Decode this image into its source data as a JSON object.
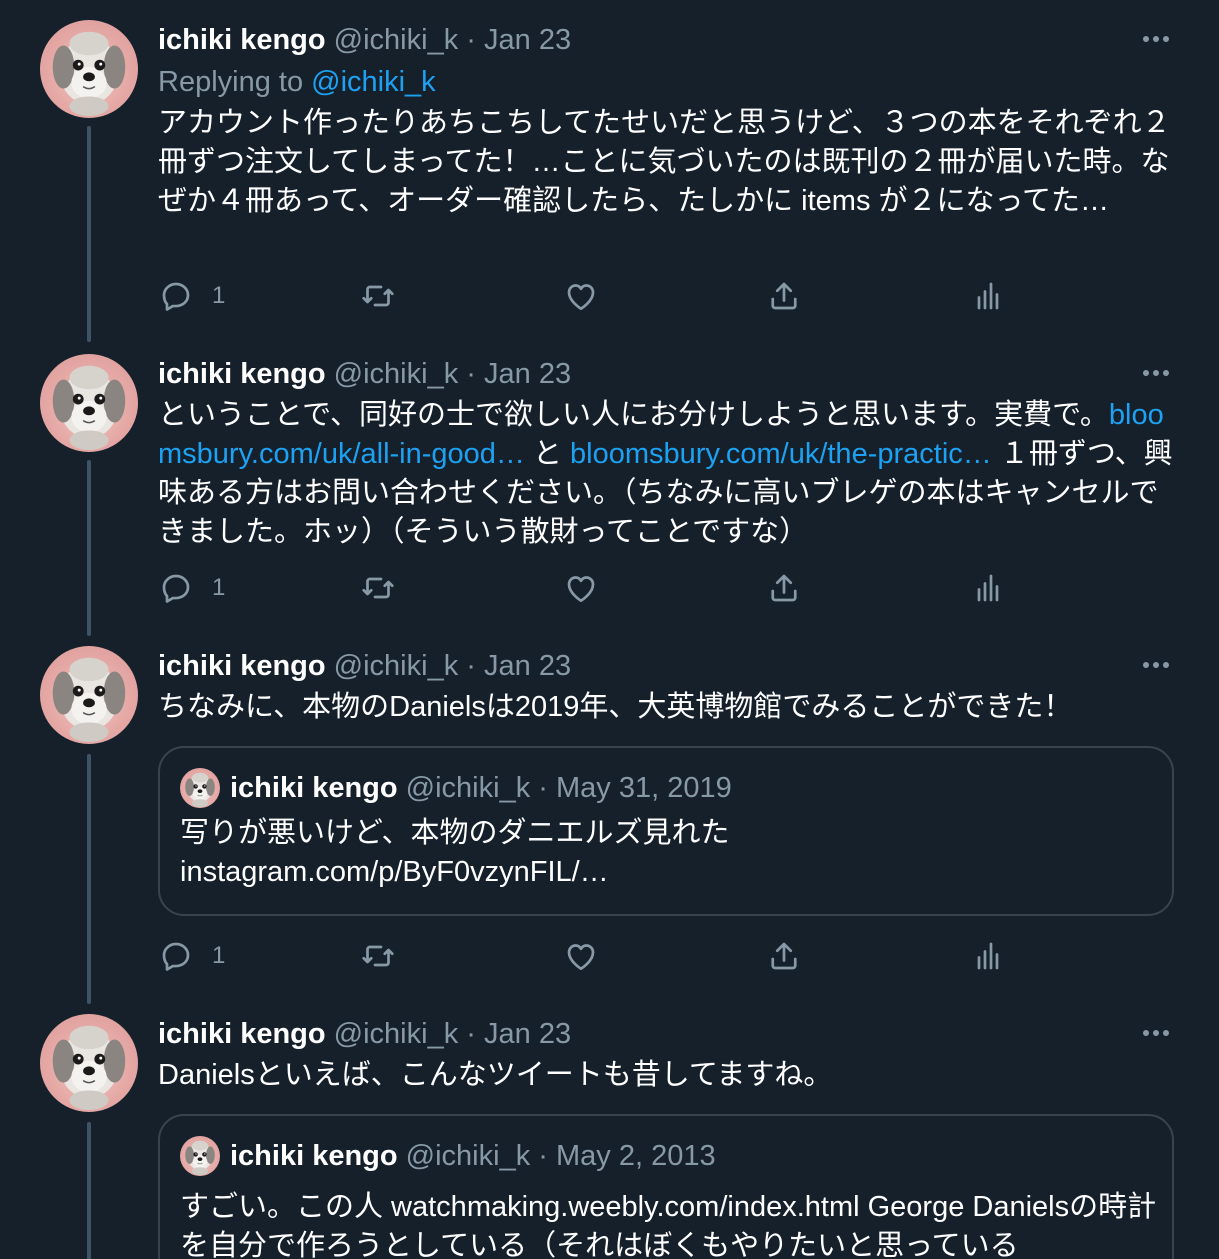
{
  "tweets": [
    {
      "name": "ichiki kengo",
      "handle": "@ichiki_k",
      "separator": "·",
      "date": "Jan 23",
      "replying_prefix": "Replying to ",
      "replying_handle": "@ichiki_k",
      "text": "アカウント作ったりあちこちしてたせいだと思うけど、３つの本をそれぞれ２冊ずつ注文してしまってた！…ことに気づいたのは既刊の２冊が届いた時。なぜか４冊あって、オーダー確認したら、たしかに items が２になってた…",
      "reply_count": "1"
    },
    {
      "name": "ichiki kengo",
      "handle": "@ichiki_k",
      "separator": "·",
      "date": "Jan 23",
      "text_part1": "ということで、同好の士で欲しい人にお分けしようと思います。実費で。",
      "link1": "bloomsbury.com/uk/all-in-good…",
      "text_part2": " と ",
      "link2": "bloomsbury.com/uk/the-practic…",
      "text_part3": " １冊ずつ、興味ある方はお問い合わせください。（ちなみに高いブレゲの本はキャンセルできました。ホッ）（そういう散財ってことですな）",
      "reply_count": "1"
    },
    {
      "name": "ichiki kengo",
      "handle": "@ichiki_k",
      "separator": "·",
      "date": "Jan 23",
      "text": "ちなみに、本物のDanielsは2019年、大英博物館でみることができた！",
      "quote": {
        "name": "ichiki kengo",
        "handle": "@ichiki_k",
        "separator": "·",
        "date": "May 31, 2019",
        "text": "写りが悪いけど、本物のダニエルズ見れた\ninstagram.com/p/ByF0vzynFIL/…"
      },
      "reply_count": "1"
    },
    {
      "name": "ichiki kengo",
      "handle": "@ichiki_k",
      "separator": "·",
      "date": "Jan 23",
      "text": "Danielsといえば、こんなツイートも昔してますね。",
      "quote": {
        "name": "ichiki kengo",
        "handle": "@ichiki_k",
        "separator": "·",
        "date": "May 2, 2013",
        "text": "すごい。この人 watchmaking.weebly.com/index.html George Danielsの時計を自分で作ろうとしている（それはぼくもやりたいと思っている"
      }
    }
  ],
  "icons": {
    "reply": "reply-icon",
    "retweet": "retweet-icon",
    "like": "like-icon",
    "share": "share-icon",
    "analytics": "analytics-icon",
    "more": "more-icon"
  },
  "colors": {
    "background": "#15202b",
    "text": "#ffffff",
    "secondary": "#8899a6",
    "link": "#1da1f2",
    "border": "#38444d"
  }
}
